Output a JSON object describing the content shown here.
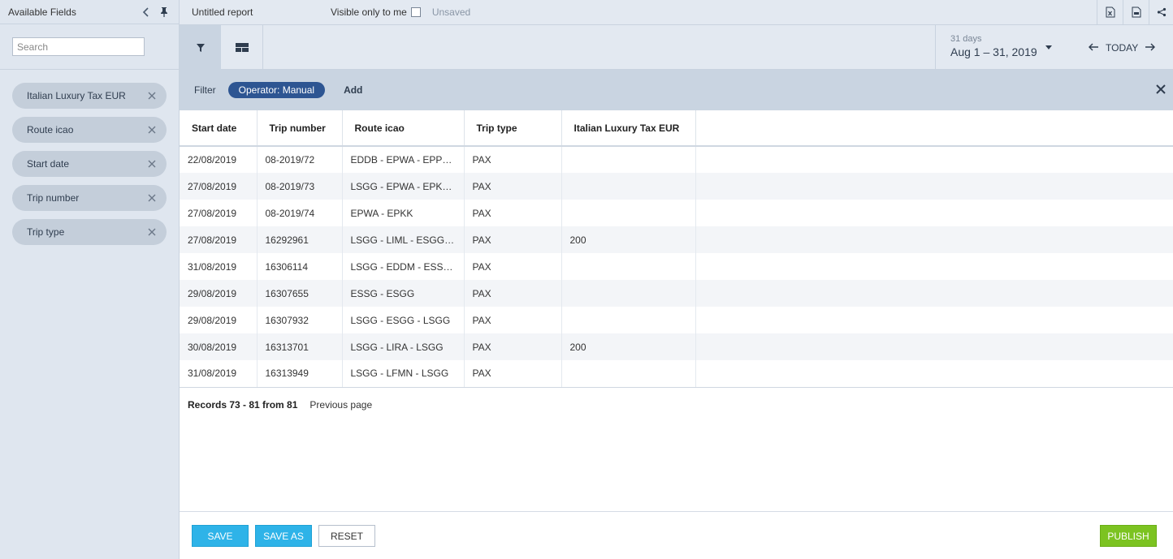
{
  "sidebar": {
    "title": "Available Fields",
    "search_placeholder": "Search",
    "fields": [
      {
        "label": "Italian Luxury Tax EUR"
      },
      {
        "label": "Route icao"
      },
      {
        "label": "Start date"
      },
      {
        "label": "Trip number"
      },
      {
        "label": "Trip type"
      }
    ]
  },
  "topbar": {
    "report_title": "Untitled report",
    "visible_label": "Visible only to me",
    "status": "Unsaved"
  },
  "daterange": {
    "days": "31 days",
    "range": "Aug 1 – 31, 2019",
    "today": "TODAY"
  },
  "filter": {
    "label": "Filter",
    "pill": "Operator: Manual",
    "add": "Add"
  },
  "table": {
    "columns": [
      "Start date",
      "Trip number",
      "Route icao",
      "Trip type",
      "Italian Luxury Tax EUR"
    ],
    "rows": [
      [
        "22/08/2019",
        "08-2019/72",
        "EDDB - EPWA - EPPO - EDDB",
        "PAX",
        ""
      ],
      [
        "27/08/2019",
        "08-2019/73",
        "LSGG - EPWA - EPKK - LSGG",
        "PAX",
        ""
      ],
      [
        "27/08/2019",
        "08-2019/74",
        "EPWA - EPKK",
        "PAX",
        ""
      ],
      [
        "27/08/2019",
        "16292961",
        "LSGG - LIML - ESGG - LSGG",
        "PAX",
        "200"
      ],
      [
        "31/08/2019",
        "16306114",
        "LSGG - EDDM - ESSB - LSGG",
        "PAX",
        ""
      ],
      [
        "29/08/2019",
        "16307655",
        "ESSG - ESGG",
        "PAX",
        ""
      ],
      [
        "29/08/2019",
        "16307932",
        "LSGG - ESGG - LSGG",
        "PAX",
        ""
      ],
      [
        "30/08/2019",
        "16313701",
        "LSGG - LIRA - LSGG",
        "PAX",
        "200"
      ],
      [
        "31/08/2019",
        "16313949",
        "LSGG - LFMN - LSGG",
        "PAX",
        ""
      ]
    ]
  },
  "pagination": {
    "records": "Records 73 - 81 from 81",
    "previous": "Previous page"
  },
  "footer": {
    "save": "SAVE",
    "save_as": "SAVE AS",
    "reset": "RESET",
    "publish": "PUBLISH"
  },
  "colors": {
    "accent_blue": "#2eb3e8",
    "publish_green": "#7cc321",
    "filter_pill": "#2d5592"
  }
}
